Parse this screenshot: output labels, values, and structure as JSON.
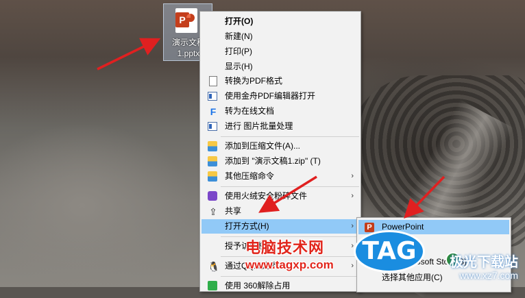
{
  "desktop_file": {
    "name_line1": "演示文稿",
    "name_line2": "1.pptx",
    "badge": "P"
  },
  "context_menu": {
    "items": [
      {
        "label": "打开(O)",
        "icon": "none"
      },
      {
        "label": "新建(N)",
        "icon": "none"
      },
      {
        "label": "打印(P)",
        "icon": "none"
      },
      {
        "label": "显示(H)",
        "icon": "none"
      },
      {
        "label": "转换为PDF格式",
        "icon": "page-icon"
      },
      {
        "label": "使用金舟PDF编辑器打开",
        "icon": "window-icon"
      },
      {
        "label": "转为在线文档",
        "icon": "online-doc-icon"
      },
      {
        "label": "进行 图片批量处理",
        "icon": "window-icon"
      },
      {
        "label": "添加到压缩文件(A)...",
        "icon": "zip-icon"
      },
      {
        "label": "添加到 \"演示文稿1.zip\" (T)",
        "icon": "zip-icon"
      },
      {
        "label": "其他压缩命令",
        "icon": "zip-icon"
      },
      {
        "label": "使用火绒安全粉碎文件",
        "icon": "shredder-icon"
      },
      {
        "label": "共享",
        "icon": "share-icon"
      },
      {
        "label": "打开方式(H)",
        "icon": "none"
      },
      {
        "label": "授予访问权限",
        "icon": "none"
      },
      {
        "label": "通过QQ发送到",
        "icon": "qq-icon"
      },
      {
        "label": "使用 360解除占用",
        "icon": "360-icon"
      }
    ],
    "arrow_glyph": "›"
  },
  "open_with_submenu": {
    "items": [
      {
        "label": "PowerPoint",
        "icon": "powerpoint-icon"
      },
      {
        "label": "搜索 Microsoft Store(S)",
        "icon": "store-icon"
      },
      {
        "label": "选择其他应用(C)",
        "icon": "none"
      }
    ]
  },
  "watermarks": {
    "site_name": "电脑技术网",
    "site_url": "www.tagxp.com",
    "tag_badge": "TAG",
    "right_brand": "极光下载站",
    "right_url": "www.xz7.com"
  },
  "colors": {
    "menu_bg": "#f2f2f2",
    "highlight": "#91c9f7",
    "arrow_red": "#e02020",
    "watermark_red": "#e1251b",
    "tag_blue": "#1a8de0"
  }
}
